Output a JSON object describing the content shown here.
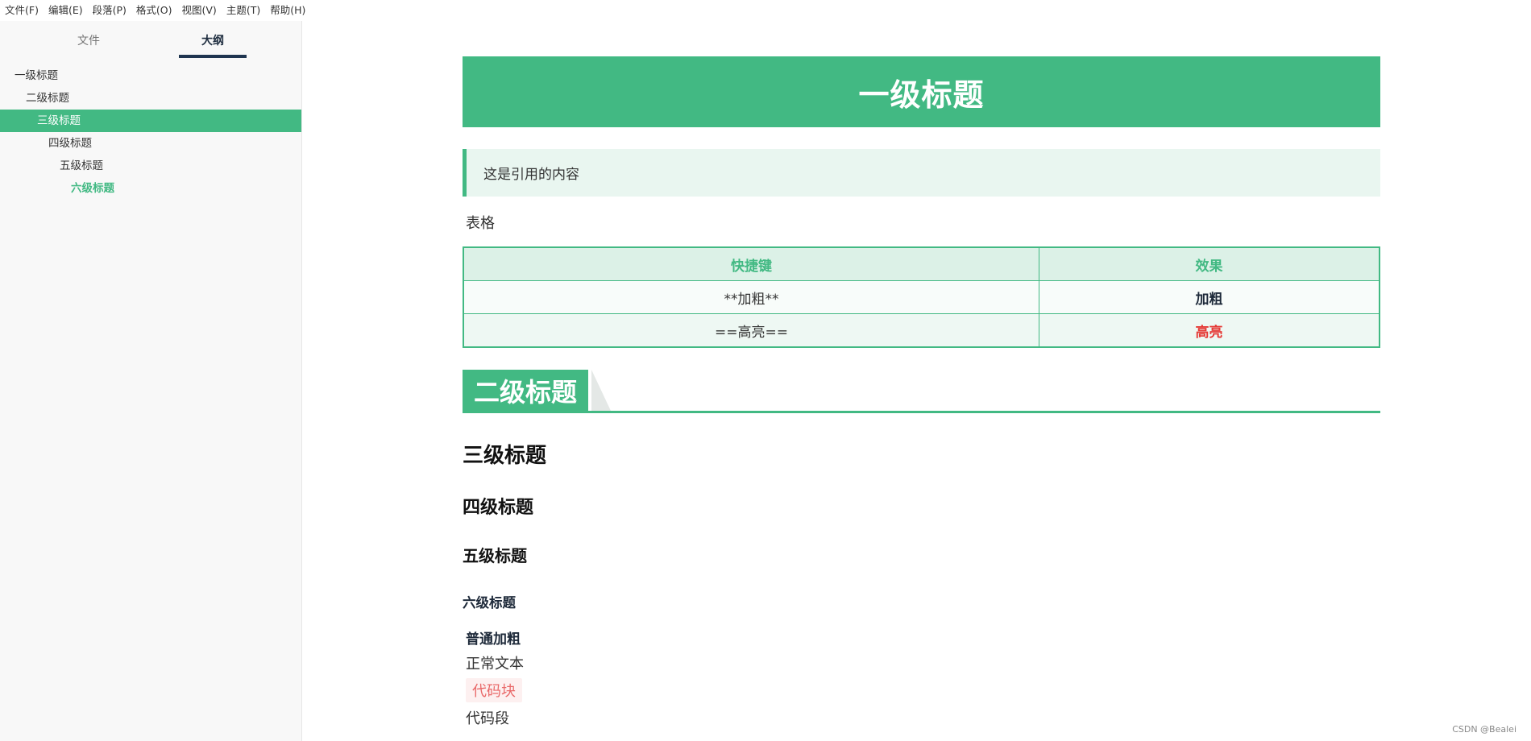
{
  "menu": [
    "文件(F)",
    "编辑(E)",
    "段落(P)",
    "格式(O)",
    "视图(V)",
    "主题(T)",
    "帮助(H)"
  ],
  "sidebar": {
    "tabs": {
      "files": "文件",
      "outline": "大纲"
    },
    "active_tab": "outline",
    "outline": [
      {
        "label": "一级标题",
        "level": 1,
        "state": "normal"
      },
      {
        "label": "二级标题",
        "level": 2,
        "state": "normal"
      },
      {
        "label": "三级标题",
        "level": 3,
        "state": "active"
      },
      {
        "label": "四级标题",
        "level": 4,
        "state": "normal"
      },
      {
        "label": "五级标题",
        "level": 5,
        "state": "normal"
      },
      {
        "label": "六级标题",
        "level": 6,
        "state": "highlight"
      }
    ]
  },
  "document": {
    "h1": "一级标题",
    "blockquote": "这是引用的内容",
    "table_caption": "表格",
    "table": {
      "headers": [
        "快捷键",
        "效果"
      ],
      "rows": [
        [
          "**加粗**",
          "加粗"
        ],
        [
          "==高亮==",
          "高亮"
        ]
      ]
    },
    "h2": "二级标题",
    "h3": "三级标题",
    "h4": "四级标题",
    "h5": "五级标题",
    "h6": "六级标题",
    "bold_text": "普通加粗",
    "normal_text": "正常文本",
    "inline_code": "代码块",
    "code_paragraph": "代码段"
  },
  "colors": {
    "accent": "#42b983",
    "highlight_red": "#e53935",
    "code_pink": "#e96969",
    "quote_bg": "#e9f6f0"
  },
  "watermark": "CSDN @Bealei"
}
